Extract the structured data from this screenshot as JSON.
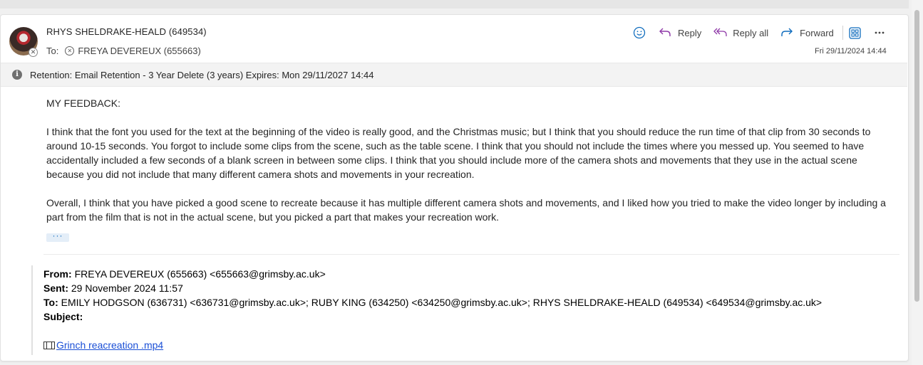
{
  "email": {
    "sender": "RHYS SHELDRAKE-HEALD (649534)",
    "to_label": "To:",
    "recipient": "FREYA DEVEREUX (655663)",
    "date": "Fri 29/11/2024 14:44",
    "actions": {
      "reply": "Reply",
      "reply_all": "Reply all",
      "forward": "Forward"
    },
    "retention": "Retention: Email Retention - 3 Year Delete (3 years) Expires: Mon 29/11/2027 14:44",
    "body": {
      "heading": "MY FEEDBACK:",
      "paragraph1": "I think that the font you used for the text at the beginning of the video is really good, and the Christmas music; but I think that you should reduce the run time of that clip from 30 seconds to around 10-15 seconds. You forgot to include some clips from the scene, such as the table scene. I think that you should not include the times where you messed up. You seemed to have accidentally included a few seconds of a blank screen in between some clips. I think that you should include more of the camera shots and movements that they use in the actual scene because you did not include that many different camera shots and movements in your recreation.",
      "paragraph2": "Overall, I think that you have picked a good scene to recreate because it has multiple different camera shots and movements, and I liked how you tried to make the video longer by including a part from the film that is not in the actual scene, but you picked a part that makes your recreation work.",
      "ellipsis": "···"
    },
    "quoted": {
      "from_label": "From:",
      "from": "FREYA DEVEREUX (655663) <655663@grimsby.ac.uk>",
      "sent_label": "Sent:",
      "sent": "29 November 2024 11:57",
      "to_label": "To:",
      "to": "EMILY HODGSON (636731) <636731@grimsby.ac.uk>; RUBY KING (634250) <634250@grimsby.ac.uk>; RHYS SHELDRAKE-HEALD (649534) <649534@grimsby.ac.uk>",
      "subject_label": "Subject:",
      "subject": "",
      "attachment": "Grinch reacreation .mp4"
    }
  },
  "colors": {
    "accent_blue": "#0f6cbd",
    "reply_purple": "#8f3aa8",
    "link": "#1a4fd6"
  },
  "icons": [
    "emoji-icon",
    "reply-icon",
    "reply-all-icon",
    "forward-icon",
    "immersive-reader-icon",
    "more-icon",
    "info-icon",
    "film-icon"
  ]
}
